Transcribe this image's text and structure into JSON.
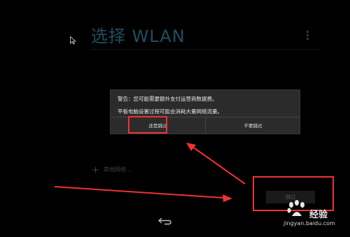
{
  "header": {
    "title": "选择 WLAN"
  },
  "wlan": {
    "other_networks": "其他网络..."
  },
  "dialog": {
    "warning": "警告：您可能需要额外支付运营商数据费。",
    "message": "平板电脑设置过程可能会消耗大量网络流量。",
    "btn_skip_anyway": "还是跳过",
    "btn_dont_skip": "不要跳过"
  },
  "footer": {
    "skip_label": "跳过"
  },
  "watermark": {
    "brand": "经验",
    "url": "jingyan.baidu.com"
  },
  "icons": {
    "menu": "overflow-menu-icon",
    "back": "back-icon",
    "cursor": "mouse-pointer-icon",
    "add": "plus-icon"
  },
  "colors": {
    "title": "#1f4f60",
    "highlight": "#ee3333",
    "dialog_bg": "#2b2b2b"
  }
}
